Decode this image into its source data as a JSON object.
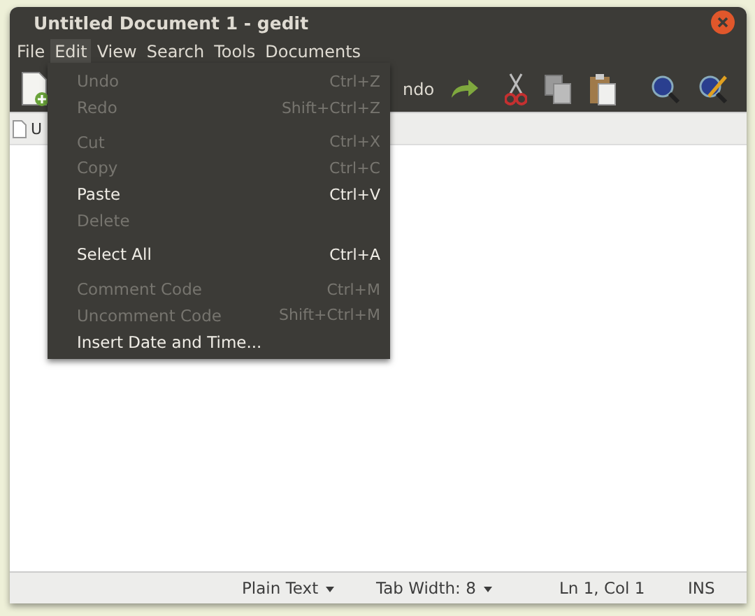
{
  "window": {
    "title": "Untitled Document 1 - gedit"
  },
  "menubar": [
    {
      "label": "File",
      "selected": false
    },
    {
      "label": "Edit",
      "selected": true
    },
    {
      "label": "View",
      "selected": false
    },
    {
      "label": "Search",
      "selected": false
    },
    {
      "label": "Tools",
      "selected": false
    },
    {
      "label": "Documents",
      "selected": false
    }
  ],
  "toolbar": {
    "partial_label": "ndo"
  },
  "tab": {
    "label": "U"
  },
  "edit_menu": [
    {
      "kind": "item",
      "label": "Undo",
      "shortcut": "Ctrl+Z",
      "disabled": true
    },
    {
      "kind": "item",
      "label": "Redo",
      "shortcut": "Shift+Ctrl+Z",
      "disabled": true
    },
    {
      "kind": "separator"
    },
    {
      "kind": "item",
      "label": "Cut",
      "shortcut": "Ctrl+X",
      "disabled": true
    },
    {
      "kind": "item",
      "label": "Copy",
      "shortcut": "Ctrl+C",
      "disabled": true
    },
    {
      "kind": "item",
      "label": "Paste",
      "shortcut": "Ctrl+V",
      "disabled": false
    },
    {
      "kind": "item",
      "label": "Delete",
      "disabled": true
    },
    {
      "kind": "separator"
    },
    {
      "kind": "item",
      "label": "Select All",
      "shortcut": "Ctrl+A",
      "disabled": false
    },
    {
      "kind": "separator"
    },
    {
      "kind": "item",
      "label": "Comment Code",
      "shortcut": "Ctrl+M",
      "disabled": true
    },
    {
      "kind": "item",
      "label": "Uncomment Code",
      "shortcut": "Shift+Ctrl+M",
      "disabled": true
    },
    {
      "kind": "item",
      "label": "Insert Date and Time...",
      "disabled": false
    }
  ],
  "status_bar": {
    "language": "Plain Text",
    "tab_width": "Tab Width:  8",
    "position": "Ln 1, Col 1",
    "mode": "INS"
  }
}
